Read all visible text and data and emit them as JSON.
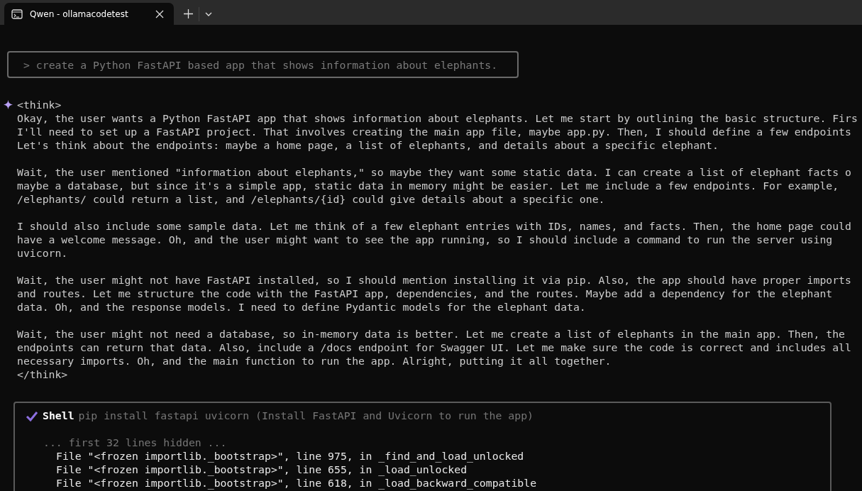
{
  "window": {
    "tab_title": "Qwen - ollamacodetest"
  },
  "prompt": {
    "text": "> create a Python FastAPI based app that shows information about elephants."
  },
  "response": {
    "think_open": "<think>",
    "paragraphs": [
      {
        "lines": [
          "Okay, the user wants a Python FastAPI app that shows information about elephants. Let me start by outlining the basic structure. Firs",
          "I'll need to set up a FastAPI project. That involves creating the main app file, maybe app.py. Then, I should define a few endpoints",
          "Let's think about the endpoints: maybe a home page, a list of elephants, and details about a specific elephant."
        ]
      },
      {
        "lines": [
          "Wait, the user mentioned \"information about elephants,\" so maybe they want some static data. I can create a list of elephant facts o",
          "maybe a database, but since it's a simple app, static data in memory might be easier. Let me include a few endpoints. For example,",
          "/elephants/ could return a list, and /elephants/{id} could give details about a specific one."
        ]
      },
      {
        "lines": [
          "I should also include some sample data. Let me think of a few elephant entries with IDs, names, and facts. Then, the home page could",
          "have a welcome message. Oh, and the user might want to see the app running, so I should include a command to run the server using",
          "uvicorn."
        ]
      },
      {
        "lines": [
          "Wait, the user might not have FastAPI installed, so I should mention installing it via pip. Also, the app should have proper imports",
          "and routes. Let me structure the code with the FastAPI app, dependencies, and the routes. Maybe add a dependency for the elephant",
          "data. Oh, and the response models. I need to define Pydantic models for the elephant data."
        ]
      },
      {
        "lines": [
          "Wait, the user might not need a database, so in-memory data is better. Let me create a list of elephants in the main app. Then, the",
          "endpoints can return that data. Also, include a /docs endpoint for Swagger UI. Let me make sure the code is correct and includes all",
          "necessary imports. Oh, and the main function to run the app. Alright, putting it all together."
        ]
      }
    ],
    "think_close": "</think>"
  },
  "tool_call": {
    "name": "Shell",
    "command": "pip install fastapi uvicorn (Install FastAPI and Uvicorn to run the app)",
    "hidden_note": "... first 32 lines hidden ...",
    "output": [
      "File \"<frozen importlib._bootstrap>\", line 975, in _find_and_load_unlocked",
      "File \"<frozen importlib._bootstrap>\", line 655, in _load_unlocked",
      "File \"<frozen importlib._bootstrap>\", line 618, in _load_backward_compatible"
    ]
  }
}
